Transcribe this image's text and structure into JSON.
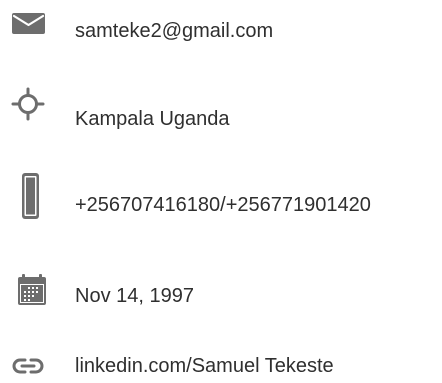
{
  "contact": {
    "email": "samteke2@gmail.com",
    "location": "Kampala Uganda",
    "phone": "+256707416180/+256771901420",
    "birthdate": "Nov 14, 1997",
    "linkedin": "linkedin.com/Samuel Tekeste"
  },
  "icons": {
    "email": "envelope-icon",
    "location": "gps-target-icon",
    "phone": "mobile-phone-icon",
    "birthdate": "calendar-icon",
    "linkedin": "link-icon"
  },
  "colors": {
    "icon": "#6d6d6d",
    "text": "#2f2f2f"
  }
}
